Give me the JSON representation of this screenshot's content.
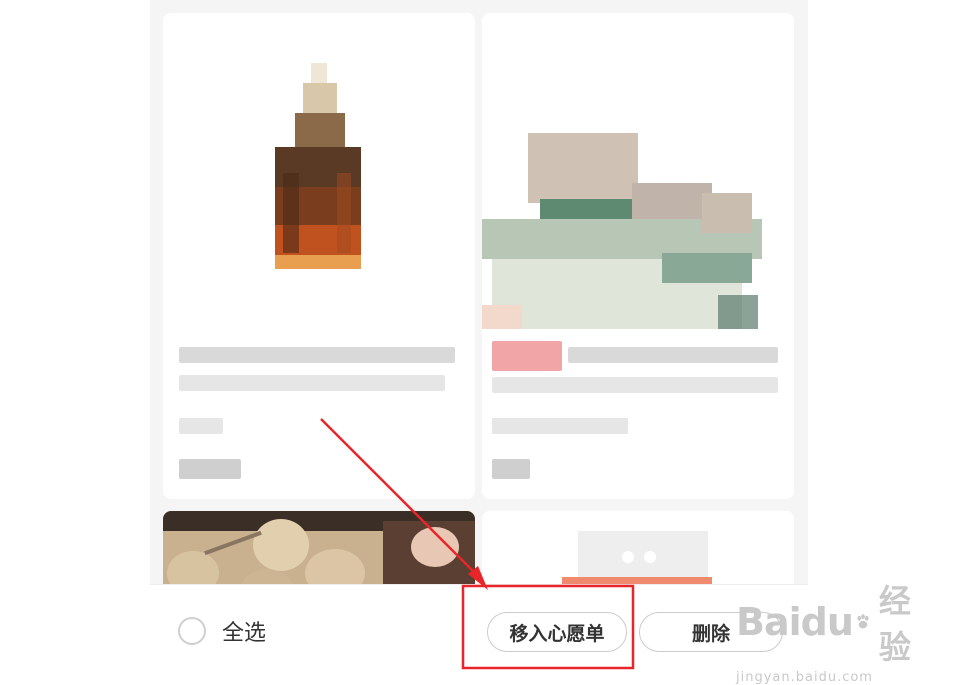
{
  "bottom_bar": {
    "select_all_label": "全选",
    "move_to_wishlist_label": "移入心愿单",
    "delete_label": "删除"
  },
  "annotation": {
    "highlight_color": "#e8262a",
    "arrow_color": "#e8262a"
  },
  "watermark": {
    "logo_text": "Baidu",
    "logo_suffix": "经验",
    "url": "jingyan.baidu.com"
  },
  "icons": {
    "radio": "radio-unchecked-icon",
    "paw": "baidu-paw-icon"
  }
}
